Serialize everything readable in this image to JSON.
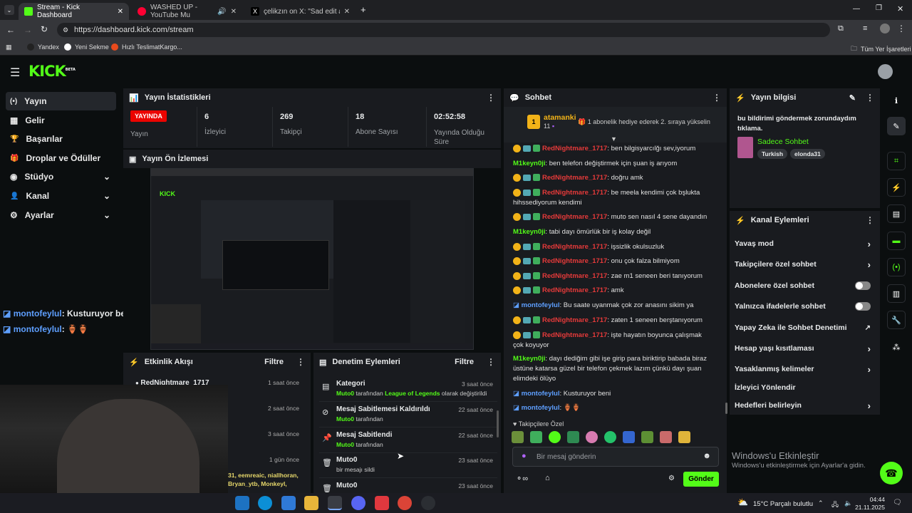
{
  "browser": {
    "tabs": [
      {
        "title": "Stream - Kick Dashboard"
      },
      {
        "title": "WASHED UP - YouTube Mu"
      },
      {
        "title": "çelikzın on X: \"Sad edit atar m"
      }
    ],
    "url": "https://dashboard.kick.com/stream",
    "bookmarks": [
      "Yandex",
      "Yeni Sekme",
      "Hızlı TeslimatKargo..."
    ],
    "all_bookmarks": "Tüm Yer İşaretleri"
  },
  "header": {
    "logo": "KICK",
    "beta": "BETA"
  },
  "sidebar": {
    "items": [
      {
        "label": "Yayın",
        "icon": "(•)"
      },
      {
        "label": "Gelir",
        "icon": "▦"
      },
      {
        "label": "Başarılar",
        "icon": "🏆"
      },
      {
        "label": "Droplar ve Ödüller",
        "icon": "🎁"
      },
      {
        "label": "Stüdyo",
        "icon": "◉"
      },
      {
        "label": "Kanal",
        "icon": "👤"
      },
      {
        "label": "Ayarlar",
        "icon": "⚙"
      }
    ]
  },
  "stats": {
    "title": "Yayın İstatistikleri",
    "live_badge": "YAYINDA",
    "live_label": "Yayın",
    "items": [
      {
        "value": "6",
        "label": "İzleyici"
      },
      {
        "value": "269",
        "label": "Takipçi"
      },
      {
        "value": "18",
        "label": "Abone Sayısı"
      },
      {
        "value": "02:52:58",
        "label": "Yayında Olduğu Süre"
      }
    ]
  },
  "preview": {
    "title": "Yayın Ön İzlemesi"
  },
  "overlay_chat": [
    {
      "user": "montofeylul",
      "text": ": Kusturuyor beni"
    },
    {
      "user": "montofeylul",
      "text": ": 🏺🏺"
    }
  ],
  "events": {
    "title": "Etkinlik Akışı",
    "filter": "Filtre",
    "items": [
      {
        "name": "RedNightmare_1717",
        "time": "1 saat önce"
      },
      {
        "name": "",
        "time": "2 saat önce"
      },
      {
        "name": "",
        "time": "3 saat önce"
      },
      {
        "name": "",
        "time": "1 gün önce"
      }
    ],
    "footer_names": "31, eemreaic, niallhoran,",
    "footer_names2": "Bryan_ytb, Monkeyl,"
  },
  "mod": {
    "title": "Denetim Eylemleri",
    "filter": "Filtre",
    "items": [
      {
        "title": "Kategori",
        "by": "Muto0",
        "sub": "tarafından",
        "cat": "League of Legends",
        "tail": "olarak değiştirildi",
        "time": "3 saat önce",
        "icon": "▤"
      },
      {
        "title": "Mesaj Sabitlemesi Kaldırıldı",
        "by": "Muto0",
        "sub": "tarafından",
        "cat": "",
        "tail": "",
        "time": "22 saat önce",
        "icon": "⊘"
      },
      {
        "title": "Mesaj Sabitlendi",
        "by": "Muto0",
        "sub": "tarafından",
        "cat": "",
        "tail": "",
        "time": "22 saat önce",
        "icon": "📌"
      },
      {
        "title": "Muto0",
        "by": "",
        "sub": "bir mesajı sildi",
        "cat": "",
        "tail": "",
        "time": "23 saat önce",
        "icon": "🗑"
      },
      {
        "title": "Muto0",
        "by": "",
        "sub": "",
        "cat": "",
        "tail": "",
        "time": "23 saat önce",
        "icon": "🗑"
      }
    ]
  },
  "chat": {
    "title": "Sohbet",
    "pinned_user": "atamanki",
    "pinned_count": "11",
    "pinned_badge": "1",
    "pinned_text": "1 abonelik hediye ederek 2. sıraya yükselin",
    "messages": [
      {
        "user": "RedNightmare_1717",
        "color": "red",
        "text": ": ben bilgisyarcılğı sev,iyorum",
        "badges": true
      },
      {
        "user": "M1keyn0ji",
        "color": "grn",
        "text": ": ben telefon değiştirmek için şuan iş arıyom",
        "badges": false
      },
      {
        "user": "RedNightmare_1717",
        "color": "red",
        "text": ": doğru amk",
        "badges": true
      },
      {
        "user": "RedNightmare_1717",
        "color": "red",
        "text": ": be meela kendimi çok bşlukta hihssediyorum kendimi",
        "badges": true
      },
      {
        "user": "RedNightmare_1717",
        "color": "red",
        "text": ": muto sen nasıl 4 sene dayandın",
        "badges": true
      },
      {
        "user": "M1keyn0ji",
        "color": "grn",
        "text": ": tabi dayı ömürlük bir iş kolay değil",
        "badges": false
      },
      {
        "user": "RedNightmare_1717",
        "color": "red",
        "text": ": işsizlik okulsuzluk",
        "badges": true
      },
      {
        "user": "RedNightmare_1717",
        "color": "red",
        "text": ": onu çok falza bilmiyom",
        "badges": true
      },
      {
        "user": "RedNightmare_1717",
        "color": "red",
        "text": ": zae m1 seneen beri tanıyorum",
        "badges": true
      },
      {
        "user": "RedNightmare_1717",
        "color": "red",
        "text": ": amk",
        "badges": true
      },
      {
        "user": "montofeylul",
        "color": "blu",
        "text": ": Bu saate uyanmak çok zor anasını sikim ya",
        "badges": false
      },
      {
        "user": "RedNightmare_1717",
        "color": "red",
        "text": ": zaten 1 seneen berştanıyorum",
        "badges": true
      },
      {
        "user": "RedNightmare_1717",
        "color": "red",
        "text": ": işte hayatın boyunca çalışmak çok koyuyor",
        "badges": true
      },
      {
        "user": "M1keyn0ji",
        "color": "grn",
        "text": ": dayı dediğim gibi işe girip para biriktirip babada biraz üstüne katarsa güzel bir telefon çekmek lazım çünkü dayı şuan elimdeki ölüyo",
        "badges": false
      },
      {
        "user": "montofeylul",
        "color": "blu",
        "text": ": Kusturuyor beni",
        "badges": false
      },
      {
        "user": "montofeylul",
        "color": "blu",
        "text": ": 🏺🏺",
        "badges": false
      }
    ],
    "followers_only": "Takipçilere Özel",
    "placeholder": "Bir mesaj gönderin",
    "send": "Gönder"
  },
  "info": {
    "title": "Yayın bilgisi",
    "text": "bu bildirimi göndermek zorundaydım tıklama.",
    "category": "Sadece Sohbet",
    "tags": [
      "Turkish",
      "elonda31"
    ]
  },
  "actions": {
    "title": "Kanal Eylemleri",
    "items": [
      {
        "label": "Yavaş mod",
        "kind": "chevron"
      },
      {
        "label": "Takipçilere özel sohbet",
        "kind": "chevron"
      },
      {
        "label": "Abonelere özel sohbet",
        "kind": "toggle"
      },
      {
        "label": "Yalnızca ifadelerle sohbet",
        "kind": "toggle"
      },
      {
        "label": "Yapay Zeka ile Sohbet Denetimi",
        "kind": "external"
      },
      {
        "label": "Hesap yaşı kısıtlaması",
        "kind": "chevron"
      },
      {
        "label": "Yasaklanmış kelimeler",
        "kind": "chevron"
      },
      {
        "label": "İzleyici Yönlendir",
        "kind": "none"
      },
      {
        "label": "Hedefleri belirleyin",
        "kind": "chevron"
      }
    ]
  },
  "windows": {
    "activate_title": "Windows'u Etkinleştir",
    "activate_sub": "Windows'u etkinleştirmek için Ayarlar'a gidin.",
    "weather": "15°C  Parçalı bulutlu",
    "time": "04:44",
    "date": "21.11.2025"
  },
  "colors": {
    "accent": "#53fc18",
    "live": "#eb0400",
    "panel": "#191b1f",
    "bg": "#0b0e0f"
  }
}
